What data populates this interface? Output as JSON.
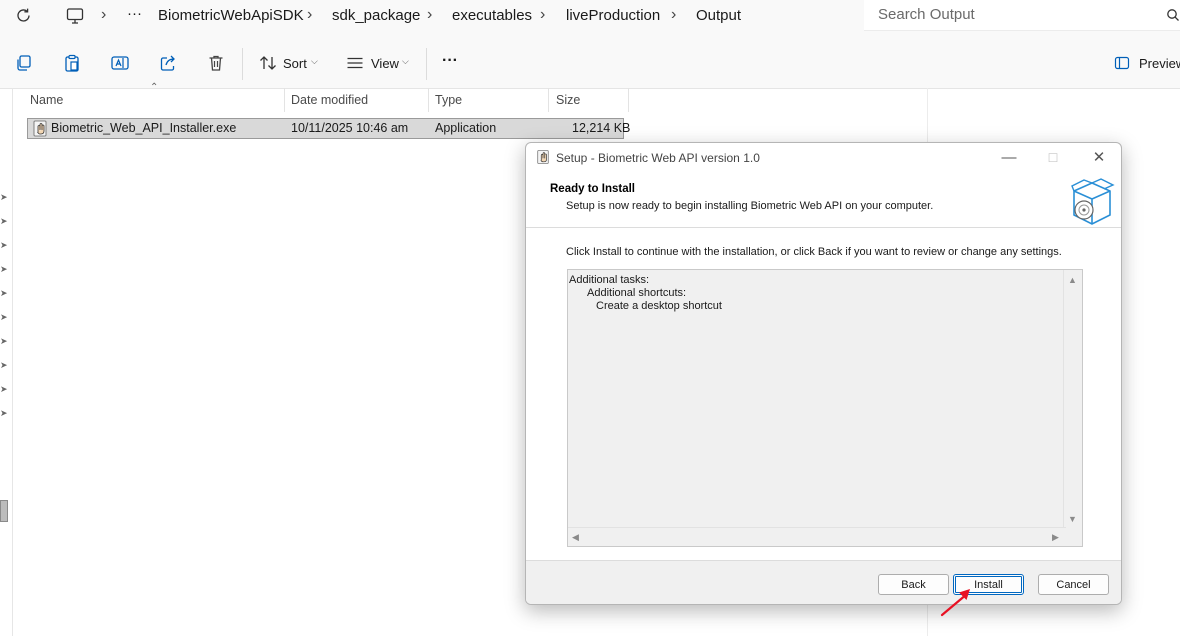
{
  "addressbar": {
    "overflow": "···",
    "crumbs": [
      "BiometricWebApiSDK",
      "sdk_package",
      "executables",
      "liveProduction",
      "Output"
    ],
    "search_placeholder": "Search Output"
  },
  "commandbar": {
    "sort_label": "Sort",
    "view_label": "View",
    "more_label": "···",
    "preview_label": "Preview"
  },
  "filelist": {
    "columns": [
      "Name",
      "Date modified",
      "Type",
      "Size"
    ],
    "rows": [
      {
        "name": "Biometric_Web_API_Installer.exe",
        "date": "10/11/2025 10:46 am",
        "type": "Application",
        "size": "12,214 KB"
      }
    ]
  },
  "dialog": {
    "title": "Setup - Biometric Web API version 1.0",
    "heading": "Ready to Install",
    "subheading": "Setup is now ready to begin installing Biometric Web API on your computer.",
    "instruction": "Click Install to continue with the installation, or click Back if you want to review or change any settings.",
    "memo_lines": [
      "Additional tasks:",
      "Additional shortcuts:",
      "Create a desktop shortcut"
    ],
    "buttons": {
      "back": "Back",
      "install": "Install",
      "cancel": "Cancel"
    }
  },
  "annotation": {
    "color": "#e81123",
    "target": "install-button"
  },
  "colors": {
    "accent": "#0067c0",
    "selection": "#d9d9d9",
    "dialog_footer": "#f0f0f0"
  }
}
